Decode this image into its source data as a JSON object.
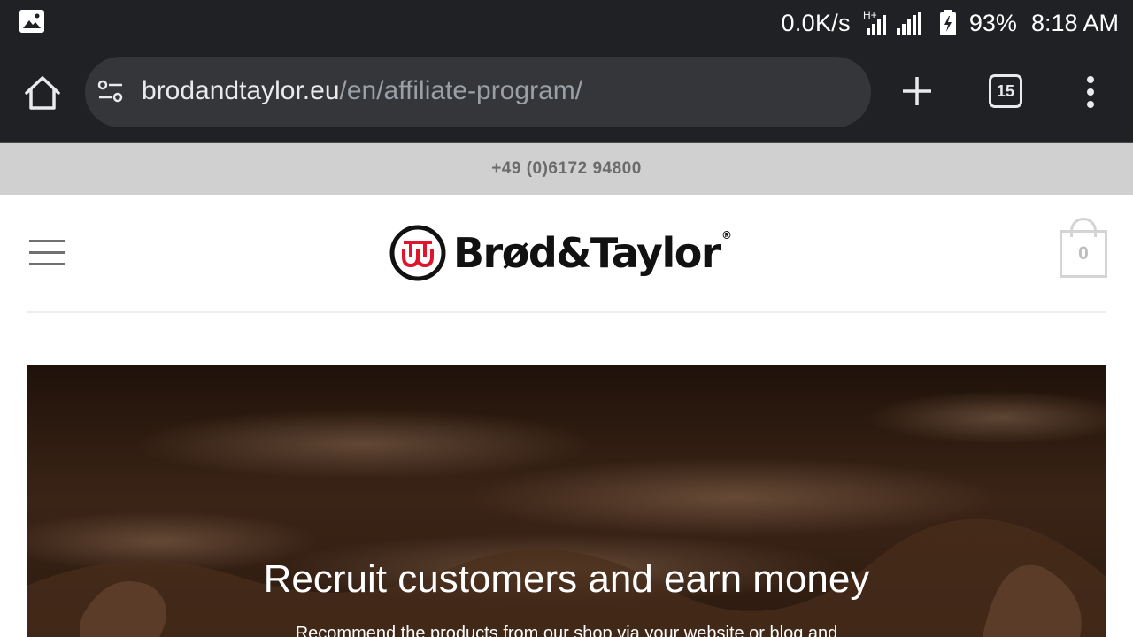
{
  "status_bar": {
    "net_speed": "0.0K/s",
    "network_type": "H+",
    "battery": "93%",
    "time": "8:18 AM"
  },
  "browser": {
    "url_domain": "brodandtaylor.eu",
    "url_path": "/en/affiliate-program/",
    "tab_count": "15"
  },
  "site": {
    "phone": "+49 (0)6172 94800",
    "logo_text": "Brød&Taylor",
    "logo_reg": "®",
    "cart_count": "0",
    "accent_color": "#e0142c"
  },
  "hero": {
    "title": "Recruit customers and earn money",
    "subtitle": "Recommend the products from our shop via your website or blog and"
  }
}
